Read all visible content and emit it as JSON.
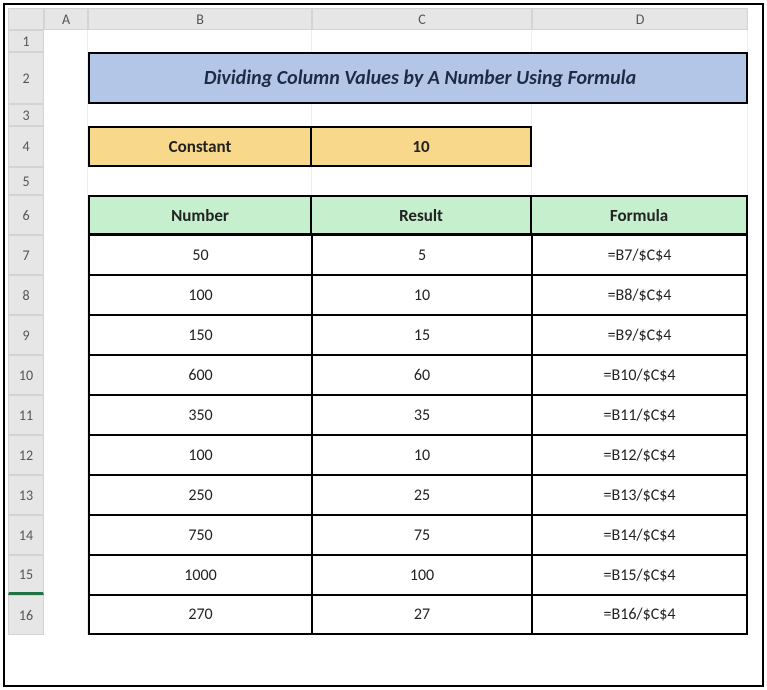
{
  "colHeaders": {
    "a": "A",
    "b": "B",
    "c": "C",
    "d": "D"
  },
  "rowNums": [
    "1",
    "2",
    "3",
    "4",
    "5",
    "6",
    "7",
    "8",
    "9",
    "10",
    "11",
    "12",
    "13",
    "14",
    "15",
    "16"
  ],
  "title": "Dividing Column Values by A  Number Using Formula",
  "constant": {
    "label": "Constant",
    "value": "10"
  },
  "tableHead": {
    "b": "Number",
    "c": "Result",
    "d": "Formula"
  },
  "rows": [
    {
      "b": "50",
      "c": "5",
      "d": "=B7/$C$4"
    },
    {
      "b": "100",
      "c": "10",
      "d": "=B8/$C$4"
    },
    {
      "b": "150",
      "c": "15",
      "d": "=B9/$C$4"
    },
    {
      "b": "600",
      "c": "60",
      "d": "=B10/$C$4"
    },
    {
      "b": "350",
      "c": "35",
      "d": "=B11/$C$4"
    },
    {
      "b": "100",
      "c": "10",
      "d": "=B12/$C$4"
    },
    {
      "b": "250",
      "c": "25",
      "d": "=B13/$C$4"
    },
    {
      "b": "750",
      "c": "75",
      "d": "=B14/$C$4"
    },
    {
      "b": "1000",
      "c": "100",
      "d": "=B15/$C$4"
    },
    {
      "b": "270",
      "c": "27",
      "d": "=B16/$C$4"
    }
  ],
  "chart_data": {
    "type": "table",
    "title": "Dividing Column Values by A Number Using Formula",
    "constant": 10,
    "columns": [
      "Number",
      "Result",
      "Formula"
    ],
    "data": [
      [
        50,
        5,
        "=B7/$C$4"
      ],
      [
        100,
        10,
        "=B8/$C$4"
      ],
      [
        150,
        15,
        "=B9/$C$4"
      ],
      [
        600,
        60,
        "=B10/$C$4"
      ],
      [
        350,
        35,
        "=B11/$C$4"
      ],
      [
        100,
        10,
        "=B12/$C$4"
      ],
      [
        250,
        25,
        "=B13/$C$4"
      ],
      [
        750,
        75,
        "=B14/$C$4"
      ],
      [
        1000,
        100,
        "=B15/$C$4"
      ],
      [
        270,
        27,
        "=B16/$C$4"
      ]
    ]
  }
}
